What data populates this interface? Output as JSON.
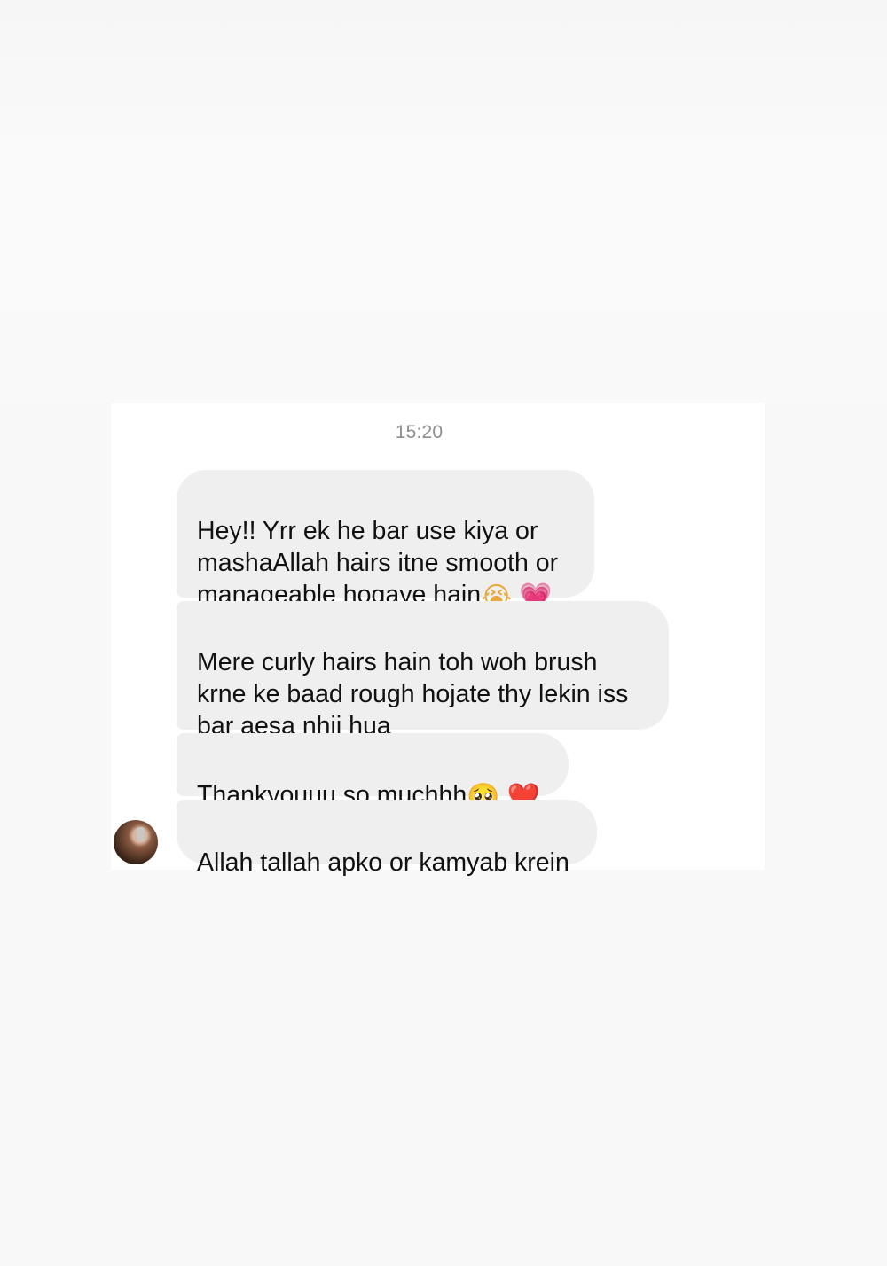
{
  "thread": {
    "timestamp": "15:20",
    "messages": [
      {
        "text": "Hey!! Yrr ek he bar use kiya or\nmashaAllah hairs itne smooth or\nmanageable hogaye hain",
        "emojis": [
          "😭",
          "💗"
        ]
      },
      {
        "text": "Mere curly hairs hain toh woh brush\nkrne ke baad rough hojate thy lekin iss\nbar aesa nhii hua"
      },
      {
        "text": "Thankyouuu so muchhh",
        "emojis": [
          "🥺",
          "❤️"
        ]
      },
      {
        "text": "Allah tallah apko or kamyab krein"
      }
    ]
  },
  "colors": {
    "page_bg": "#f8f8f8",
    "card_bg": "#ffffff",
    "bubble_bg": "#efefef",
    "timestamp_text": "#8e8e8e",
    "message_text": "#111111"
  }
}
